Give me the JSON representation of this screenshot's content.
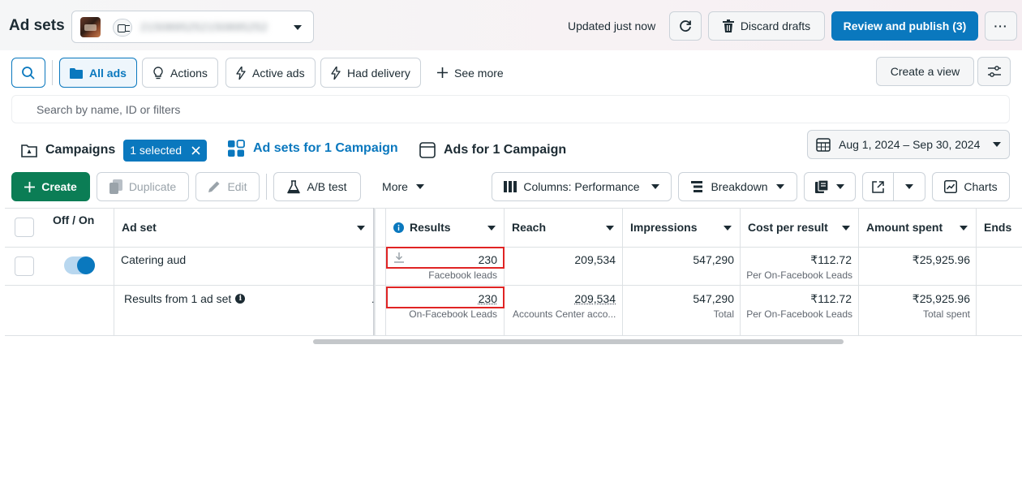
{
  "header": {
    "title": "Ad sets",
    "account_id": "2150895252150895252",
    "updated": "Updated just now",
    "discard_label": "Discard drafts",
    "publish_label": "Review and publish (3)",
    "more_label": "···"
  },
  "filters": {
    "chips": [
      "All ads",
      "Actions",
      "Active ads",
      "Had delivery",
      "See more"
    ],
    "create_view": "Create a view",
    "search_placeholder": "Search by name, ID or filters"
  },
  "tabs": {
    "campaigns": "Campaigns",
    "selected_badge": "1 selected",
    "adsets": "Ad sets for 1 Campaign",
    "ads": "Ads for 1 Campaign",
    "date_range": "Aug 1, 2024 – Sep 30, 2024"
  },
  "toolbar": {
    "create": "Create",
    "duplicate": "Duplicate",
    "edit": "Edit",
    "ab_test": "A/B test",
    "more": "More",
    "columns": "Columns: Performance",
    "breakdown": "Breakdown",
    "charts": "Charts"
  },
  "table": {
    "headers": [
      "Off / On",
      "Ad set",
      "Results",
      "Reach",
      "Impressions",
      "Cost per result",
      "Amount spent",
      "Ends"
    ],
    "rows": [
      {
        "name": "Catering aud",
        "results": "230",
        "results_sub": "Facebook leads",
        "reach": "209,534",
        "impressions": "547,290",
        "cost": "₹112.72",
        "cost_sub": "Per On-Facebook Leads",
        "spent": "₹25,925.96"
      }
    ],
    "summary": {
      "label": "Results from 1 ad set",
      "results": "230",
      "results_sub": "On-Facebook Leads",
      "reach": "209,534",
      "reach_sub": "Accounts Center acco...",
      "impressions": "547,290",
      "impressions_sub": "Total",
      "cost": "₹112.72",
      "cost_sub": "Per On-Facebook Leads",
      "spent": "₹25,925.96",
      "spent_sub": "Total spent"
    }
  },
  "colors": {
    "accent": "#0a78be",
    "create_green": "#0b7d55",
    "highlight_red": "#e02424"
  }
}
